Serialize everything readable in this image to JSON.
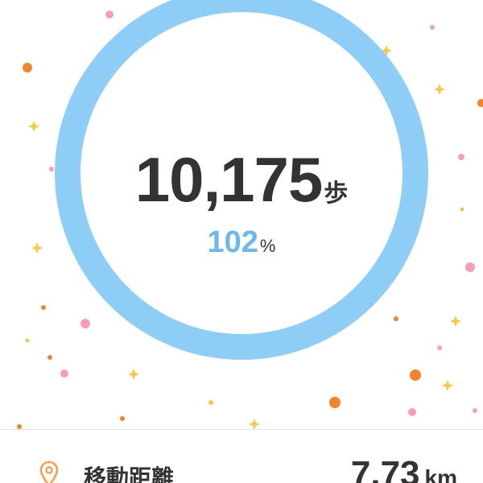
{
  "steps": {
    "value": "10,175",
    "unit": "歩"
  },
  "goal": {
    "percent_value": "102",
    "percent_unit": "%",
    "progress_fraction": 1.02
  },
  "stats": {
    "distance": {
      "icon": "location-pin-icon",
      "label": "移動距離",
      "value": "7.73",
      "unit": "km"
    }
  },
  "colors": {
    "ring": "#8ecdf6",
    "percent": "#6ab8ee",
    "text": "#333333",
    "confetti_orange": "#f5812a",
    "confetti_pink": "#f49fb6",
    "confetti_yellow": "#f7c843",
    "location_icon": "#f5a04a"
  }
}
